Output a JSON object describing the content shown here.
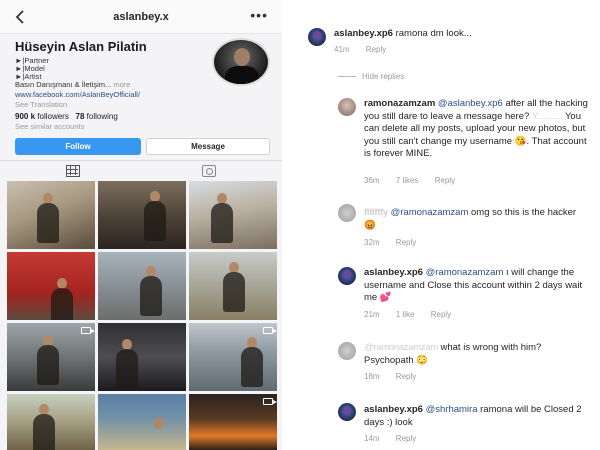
{
  "profile": {
    "username": "aslanbey.x",
    "full_name": "Hüseyin Aslan Pilatin",
    "bio": [
      "►|Partner",
      "►|Model",
      "►|Artist"
    ],
    "bio_press": "Basın Danışmanı & İletişim...",
    "bio_more": "more",
    "link": "www.facebook.com/AslanBeyOfficiall/",
    "see_translation": "See Translation",
    "followers": "900 k",
    "followers_label": "followers",
    "following": "78",
    "following_label": "following",
    "similar": "See similar accounts",
    "follow_label": "Follow",
    "message_label": "Message"
  },
  "icons": {
    "back": "chevron-left-icon",
    "more": "more-horizontal-icon",
    "grid": "grid-icon",
    "tagged": "tagged-photos-icon",
    "video": "video-icon"
  },
  "colors": {
    "follow_button": "#3897f0",
    "mention": "#2b4f8b",
    "meta_text": "#9a9a9a"
  },
  "comments": [
    {
      "user": "aslanbey.xp6",
      "text": "ramona dm look...",
      "time": "41m",
      "reply": "Reply"
    },
    {
      "hide_replies": "Hide replies"
    },
    {
      "user": "ramonazamzam",
      "mention": "@aslanbey.xp6",
      "text_a": "after all the hacking you still dare to leave a message here?",
      "redacted": "Y...........",
      "text_b": "You can delete all my posts, upload your new photos, but you still can't change my username 😘. That account is forever MINE.",
      "time": "36m",
      "likes": "7 likes",
      "reply": "Reply"
    },
    {
      "user": "flfifffy",
      "mention": "@ramonazamzam",
      "text": "omg so this is the hacker 😡",
      "time": "32m",
      "reply": "Reply"
    },
    {
      "user": "aslanbey.xp6",
      "mention": "@ramonazamzam",
      "text": "ı will change the username and Close this account within 2 days wait me 💕",
      "time": "21m",
      "likes": "1 like",
      "reply": "Reply"
    },
    {
      "user": "",
      "mention": "@ramonazamzam",
      "text": "what is wrong with him? Psychopath 😳",
      "time": "18m",
      "reply": "Reply"
    },
    {
      "user": "aslanbey.xp6",
      "mention": "@shrhamira",
      "text": "ramona will be Closed 2 days :) look",
      "time": "14m",
      "reply": "Reply"
    }
  ]
}
